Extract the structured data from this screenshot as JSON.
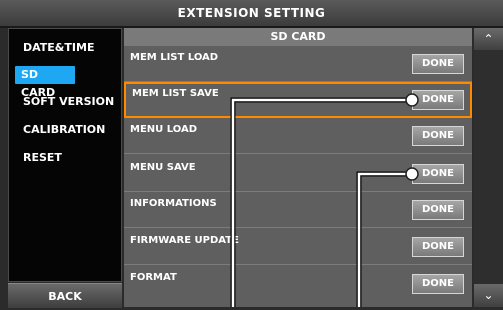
{
  "title": "EXTENSION SETTING",
  "sidebar": {
    "items": [
      {
        "label": "DATE&TIME"
      },
      {
        "label": "SD CARD"
      },
      {
        "label": "SOFT VERSION"
      },
      {
        "label": "CALIBRATION"
      },
      {
        "label": "RESET"
      }
    ],
    "back_label": "BACK"
  },
  "panel": {
    "header": "SD CARD",
    "rows": [
      {
        "label": "MEM LIST LOAD",
        "button": "DONE"
      },
      {
        "label": "MEM LIST SAVE",
        "button": "DONE"
      },
      {
        "label": "MENU LOAD",
        "button": "DONE"
      },
      {
        "label": "MENU SAVE",
        "button": "DONE"
      },
      {
        "label": "INFORMATIONS",
        "button": "DONE"
      },
      {
        "label": "FIRMWARE UPDATE",
        "button": "DONE"
      },
      {
        "label": "FORMAT",
        "button": "DONE"
      }
    ]
  },
  "scroll": {
    "up_icon": "chevron-up-icon",
    "down_icon": "chevron-down-icon"
  },
  "colors": {
    "selected": "#1ea7f2",
    "highlight": "#ff8a00"
  }
}
